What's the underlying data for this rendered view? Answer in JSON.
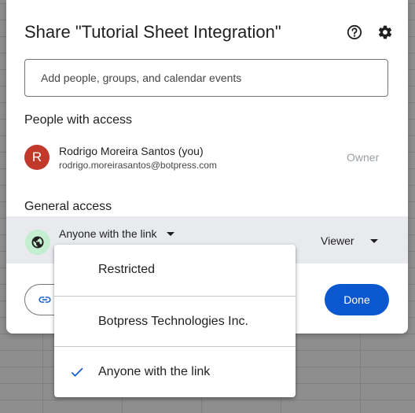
{
  "dialog": {
    "title": "Share \"Tutorial Sheet Integration\"",
    "help_icon": "help-circle-icon",
    "settings_icon": "gear-icon"
  },
  "add_people": {
    "placeholder": "Add people, groups, and calendar events"
  },
  "people_with_access": {
    "heading": "People with access",
    "people": [
      {
        "avatar_initial": "R",
        "avatar_color": "#c0392b",
        "name": "Rodrigo Moreira Santos (you)",
        "email": "rodrigo.moreirasantos@botpress.com",
        "role": "Owner"
      }
    ]
  },
  "general_access": {
    "heading": "General access",
    "selected": "Anyone with the link",
    "role": "Viewer",
    "icon": "globe-icon"
  },
  "footer": {
    "copy_link_icon": "link-icon",
    "done_label": "Done",
    "accent_color": "#0b57d0"
  },
  "access_menu": {
    "options": [
      {
        "label": "Restricted",
        "checked": false
      },
      {
        "label": "Botpress Technologies Inc.",
        "checked": false
      },
      {
        "label": "Anyone with the link",
        "checked": true
      }
    ]
  }
}
